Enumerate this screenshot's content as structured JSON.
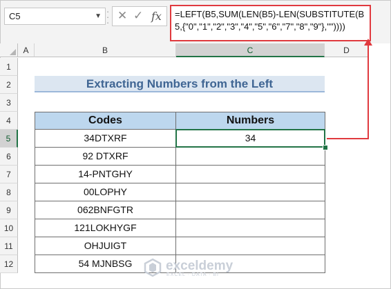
{
  "name_box": {
    "value": "C5"
  },
  "formula_bar": {
    "cancel_glyph": "✕",
    "enter_glyph": "✓",
    "fx_label": "fx",
    "formula": "=LEFT(B5,SUM(LEN(B5)-LEN(SUBSTITUTE(B5,{\"0\",\"1\",\"2\",\"3\",\"4\",\"5\",\"6\",\"7\",\"8\",\"9\"},\"\"))))"
  },
  "columns": [
    "A",
    "B",
    "C",
    "D"
  ],
  "selected_column": "C",
  "rows": [
    "1",
    "2",
    "3",
    "4",
    "5",
    "6",
    "7",
    "8",
    "9",
    "10",
    "11",
    "12"
  ],
  "selected_row": "5",
  "sheet": {
    "title": "Extracting Numbers from the Left",
    "headers": {
      "codes": "Codes",
      "numbers": "Numbers"
    },
    "records": [
      {
        "code": "34DTXRF",
        "number": "34"
      },
      {
        "code": "92 DTXRF",
        "number": ""
      },
      {
        "code": "14-PNTGHY",
        "number": ""
      },
      {
        "code": "00LOPHY",
        "number": ""
      },
      {
        "code": "062BNFGTR",
        "number": ""
      },
      {
        "code": "121LOKHYGF",
        "number": ""
      },
      {
        "code": "OHJUIGT",
        "number": ""
      },
      {
        "code": "54 MJNBSG",
        "number": ""
      }
    ]
  },
  "watermark": {
    "name": "exceldemy",
    "tagline": "EXCEL · DATA · BI"
  },
  "colors": {
    "accent_red": "#e0393e",
    "selection_green": "#217346",
    "header_fill": "#bdd7ee",
    "title_fill": "#dce6f1"
  }
}
